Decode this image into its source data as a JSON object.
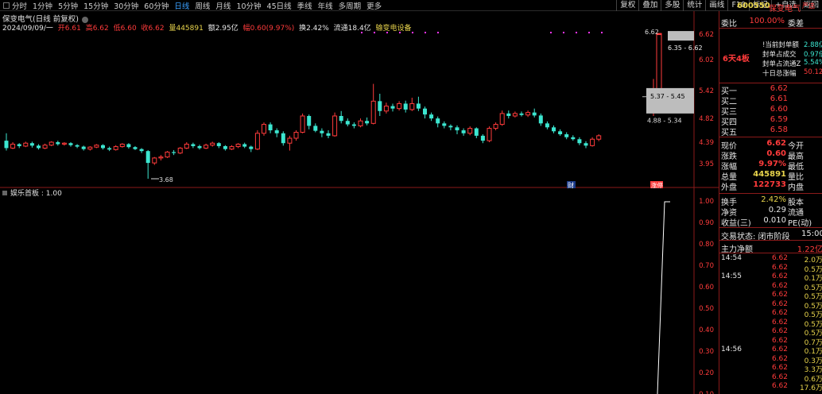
{
  "topbar": {
    "periods": [
      "分时",
      "1分钟",
      "5分钟",
      "15分钟",
      "30分钟",
      "60分钟",
      "日线",
      "周线",
      "月线",
      "10分钟",
      "45日线",
      "季线",
      "年线",
      "多周期",
      "更多"
    ],
    "active_period": "日线",
    "tools": [
      "复权",
      "叠加",
      "多股",
      "统计",
      "画线",
      "F10",
      "标记",
      "+自选",
      "返回"
    ]
  },
  "chart_title": "保变电气(日线 前复权)",
  "info": {
    "date": "2024/09/09/一",
    "open": "开6.61",
    "high": "高6.62",
    "low": "低6.60",
    "close": "收6.62",
    "volume": "量445891",
    "amount": "额2.95亿",
    "change": "幅0.60(9.97%)",
    "turnover": "换2.42%",
    "float": "流通18.4亿",
    "industry": "输变电设备"
  },
  "price_axis": [
    "6.62",
    "6.02",
    "5.42",
    "4.82",
    "4.39",
    "3.95"
  ],
  "price_notes": {
    "low_marker": "3.68",
    "top_marker": "6.62",
    "range1": "6.35 - 6.62",
    "range2": "5.37 - 5.45",
    "range3": "4.88 - 5.34"
  },
  "badges": {
    "cai": "财",
    "zhang": "涨停"
  },
  "indicator": {
    "title": "娱乐首板 : 1.00",
    "axis": [
      "1.00",
      "0.90",
      "0.80",
      "0.70",
      "0.60",
      "0.50",
      "0.40",
      "0.30",
      "0.20",
      "0.10"
    ]
  },
  "stock": {
    "code": "600550",
    "name": "保变电气",
    "tag": "严选",
    "weibi_label": "委比",
    "weibi_value": "100.00%",
    "weicha_label": "委差",
    "board_title": "6天4板",
    "board_stats": [
      {
        "label": "!当前封单额",
        "value": "2.88亿"
      },
      {
        "label": "封单占成交",
        "value": "0.97倍"
      },
      {
        "label": "封单占流通Z",
        "value": "5.54%"
      },
      {
        "label": "十日总涨幅",
        "value": "50.12%"
      }
    ],
    "bids": [
      {
        "label": "买一",
        "price": "6.62"
      },
      {
        "label": "买二",
        "price": "6.61"
      },
      {
        "label": "买三",
        "price": "6.60"
      },
      {
        "label": "买四",
        "price": "6.59"
      },
      {
        "label": "买五",
        "price": "6.58"
      }
    ],
    "quote": [
      {
        "label": "现价",
        "value": "6.62",
        "label2": "今开"
      },
      {
        "label": "涨跌",
        "value": "0.60",
        "label2": "最高"
      },
      {
        "label": "涨幅",
        "value": "9.97%",
        "label2": "最低"
      },
      {
        "label": "总量",
        "value": "445891",
        "label2": "量比"
      },
      {
        "label": "外盘",
        "value": "122733",
        "label2": "内盘"
      }
    ],
    "quote2": [
      {
        "label": "换手",
        "value": "2.42%",
        "label2": "股本"
      },
      {
        "label": "净资",
        "value": "0.29",
        "label2": "流通"
      },
      {
        "label": "收益(三)",
        "value": "0.010",
        "label2": "PE(动)"
      }
    ],
    "trade_status": "交易状态: 闭市阶段",
    "trade_time": "15:00:",
    "main_flow_label": "主力净额",
    "main_flow_value": "1.22亿",
    "ticks": [
      {
        "time": "14:54",
        "price": "6.62",
        "vol": "2.0万"
      },
      {
        "time": "",
        "price": "6.62",
        "vol": "0.5万"
      },
      {
        "time": "14:55",
        "price": "6.62",
        "vol": "0.1万"
      },
      {
        "time": "",
        "price": "6.62",
        "vol": "0.5万"
      },
      {
        "time": "",
        "price": "6.62",
        "vol": "0.5万"
      },
      {
        "time": "",
        "price": "6.62",
        "vol": "0.5万"
      },
      {
        "time": "",
        "price": "6.62",
        "vol": "0.5万"
      },
      {
        "time": "",
        "price": "6.62",
        "vol": "0.5万"
      },
      {
        "time": "",
        "price": "6.62",
        "vol": "0.5万"
      },
      {
        "time": "",
        "price": "6.62",
        "vol": "0.7万"
      },
      {
        "time": "14:56",
        "price": "6.62",
        "vol": "0.1万"
      },
      {
        "time": "",
        "price": "6.62",
        "vol": "0.3万"
      },
      {
        "time": "",
        "price": "6.62",
        "vol": "3.3万"
      },
      {
        "time": "",
        "price": "6.62",
        "vol": "0.6万"
      },
      {
        "time": "",
        "price": "6.62",
        "vol": "17.6万"
      }
    ]
  },
  "colors": {
    "up": "#ff3b3b",
    "down": "#3ce6d0",
    "accent": "#3aa0ff",
    "gridline": "#8b1a1a"
  },
  "chart_data": {
    "type": "candlestick",
    "candles": [
      {
        "o": 4.45,
        "c": 4.3,
        "h": 4.6,
        "l": 4.25
      },
      {
        "o": 4.3,
        "c": 4.38,
        "h": 4.42,
        "l": 4.28
      },
      {
        "o": 4.38,
        "c": 4.34,
        "h": 4.4,
        "l": 4.3
      },
      {
        "o": 4.34,
        "c": 4.4,
        "h": 4.43,
        "l": 4.32
      },
      {
        "o": 4.4,
        "c": 4.35,
        "h": 4.43,
        "l": 4.31
      },
      {
        "o": 4.35,
        "c": 4.3,
        "h": 4.38,
        "l": 4.27
      },
      {
        "o": 4.3,
        "c": 4.36,
        "h": 4.39,
        "l": 4.28
      },
      {
        "o": 4.36,
        "c": 4.42,
        "h": 4.44,
        "l": 4.34
      },
      {
        "o": 4.42,
        "c": 4.38,
        "h": 4.45,
        "l": 4.35
      },
      {
        "o": 4.38,
        "c": 4.4,
        "h": 4.42,
        "l": 4.35
      },
      {
        "o": 4.4,
        "c": 4.36,
        "h": 4.42,
        "l": 4.33
      },
      {
        "o": 4.36,
        "c": 4.33,
        "h": 4.38,
        "l": 4.3
      },
      {
        "o": 4.33,
        "c": 4.28,
        "h": 4.35,
        "l": 4.25
      },
      {
        "o": 4.28,
        "c": 4.32,
        "h": 4.34,
        "l": 4.25
      },
      {
        "o": 4.32,
        "c": 4.36,
        "h": 4.38,
        "l": 4.3
      },
      {
        "o": 4.36,
        "c": 4.3,
        "h": 4.38,
        "l": 4.27
      },
      {
        "o": 4.3,
        "c": 4.27,
        "h": 4.33,
        "l": 4.24
      },
      {
        "o": 4.27,
        "c": 4.33,
        "h": 4.36,
        "l": 4.25
      },
      {
        "o": 4.33,
        "c": 4.38,
        "h": 4.4,
        "l": 4.31
      },
      {
        "o": 4.38,
        "c": 4.32,
        "h": 4.4,
        "l": 4.29
      },
      {
        "o": 4.32,
        "c": 4.28,
        "h": 4.34,
        "l": 4.26
      },
      {
        "o": 4.28,
        "c": 4.24,
        "h": 4.3,
        "l": 4.2
      },
      {
        "o": 4.24,
        "c": 4.0,
        "h": 4.26,
        "l": 3.68
      },
      {
        "o": 4.0,
        "c": 4.1,
        "h": 4.12,
        "l": 3.96
      },
      {
        "o": 4.1,
        "c": 4.12,
        "h": 4.16,
        "l": 4.05
      },
      {
        "o": 4.12,
        "c": 4.22,
        "h": 4.24,
        "l": 4.1
      },
      {
        "o": 4.22,
        "c": 4.2,
        "h": 4.26,
        "l": 4.16
      },
      {
        "o": 4.2,
        "c": 4.3,
        "h": 4.32,
        "l": 4.18
      },
      {
        "o": 4.3,
        "c": 4.38,
        "h": 4.42,
        "l": 4.28
      },
      {
        "o": 4.38,
        "c": 4.34,
        "h": 4.41,
        "l": 4.3
      },
      {
        "o": 4.34,
        "c": 4.3,
        "h": 4.37,
        "l": 4.27
      },
      {
        "o": 4.3,
        "c": 4.36,
        "h": 4.39,
        "l": 4.28
      },
      {
        "o": 4.36,
        "c": 4.4,
        "h": 4.43,
        "l": 4.33
      },
      {
        "o": 4.4,
        "c": 4.34,
        "h": 4.42,
        "l": 4.3
      },
      {
        "o": 4.34,
        "c": 4.28,
        "h": 4.36,
        "l": 4.25
      },
      {
        "o": 4.28,
        "c": 4.33,
        "h": 4.36,
        "l": 4.26
      },
      {
        "o": 4.33,
        "c": 4.38,
        "h": 4.4,
        "l": 4.3
      },
      {
        "o": 4.38,
        "c": 4.33,
        "h": 4.41,
        "l": 4.3
      },
      {
        "o": 4.33,
        "c": 4.28,
        "h": 4.35,
        "l": 4.22
      },
      {
        "o": 4.28,
        "c": 4.6,
        "h": 4.66,
        "l": 4.26
      },
      {
        "o": 4.6,
        "c": 4.78,
        "h": 4.82,
        "l": 4.55
      },
      {
        "o": 4.78,
        "c": 4.66,
        "h": 4.82,
        "l": 4.6
      },
      {
        "o": 4.66,
        "c": 4.6,
        "h": 4.7,
        "l": 4.52
      },
      {
        "o": 4.6,
        "c": 4.4,
        "h": 4.64,
        "l": 4.35
      },
      {
        "o": 4.4,
        "c": 4.5,
        "h": 4.55,
        "l": 4.25
      },
      {
        "o": 4.5,
        "c": 4.62,
        "h": 4.66,
        "l": 4.45
      },
      {
        "o": 4.62,
        "c": 4.95,
        "h": 5.0,
        "l": 4.6
      },
      {
        "o": 4.95,
        "c": 4.75,
        "h": 4.98,
        "l": 4.68
      },
      {
        "o": 4.75,
        "c": 4.65,
        "h": 4.8,
        "l": 4.62
      },
      {
        "o": 4.65,
        "c": 4.6,
        "h": 4.7,
        "l": 4.52
      },
      {
        "o": 4.6,
        "c": 4.55,
        "h": 4.66,
        "l": 4.5
      },
      {
        "o": 4.55,
        "c": 4.95,
        "h": 5.02,
        "l": 4.53
      },
      {
        "o": 4.95,
        "c": 4.85,
        "h": 5.05,
        "l": 4.8
      },
      {
        "o": 4.85,
        "c": 4.78,
        "h": 4.9,
        "l": 4.74
      },
      {
        "o": 4.78,
        "c": 4.75,
        "h": 4.82,
        "l": 4.7
      },
      {
        "o": 4.75,
        "c": 4.85,
        "h": 4.9,
        "l": 4.72
      },
      {
        "o": 4.85,
        "c": 4.8,
        "h": 4.92,
        "l": 4.76
      },
      {
        "o": 4.8,
        "c": 5.25,
        "h": 5.6,
        "l": 4.78
      },
      {
        "o": 5.25,
        "c": 5.05,
        "h": 5.4,
        "l": 4.95
      },
      {
        "o": 5.05,
        "c": 5.15,
        "h": 5.22,
        "l": 5.0
      },
      {
        "o": 5.15,
        "c": 5.1,
        "h": 5.2,
        "l": 5.04
      },
      {
        "o": 5.1,
        "c": 5.2,
        "h": 5.25,
        "l": 5.06
      },
      {
        "o": 5.2,
        "c": 5.08,
        "h": 5.26,
        "l": 5.02
      },
      {
        "o": 5.08,
        "c": 5.2,
        "h": 5.32,
        "l": 5.05
      },
      {
        "o": 5.2,
        "c": 5.1,
        "h": 5.34,
        "l": 5.05
      },
      {
        "o": 5.1,
        "c": 4.98,
        "h": 5.14,
        "l": 4.9
      },
      {
        "o": 4.98,
        "c": 4.9,
        "h": 5.02,
        "l": 4.85
      },
      {
        "o": 4.9,
        "c": 4.8,
        "h": 4.94,
        "l": 4.72
      },
      {
        "o": 4.8,
        "c": 4.75,
        "h": 4.84,
        "l": 4.7
      },
      {
        "o": 4.75,
        "c": 4.72,
        "h": 4.78,
        "l": 4.66
      },
      {
        "o": 4.72,
        "c": 4.66,
        "h": 4.76,
        "l": 4.58
      },
      {
        "o": 4.66,
        "c": 4.6,
        "h": 4.7,
        "l": 4.55
      },
      {
        "o": 4.6,
        "c": 4.7,
        "h": 4.74,
        "l": 4.56
      },
      {
        "o": 4.7,
        "c": 4.55,
        "h": 4.72,
        "l": 4.5
      },
      {
        "o": 4.55,
        "c": 4.45,
        "h": 4.58,
        "l": 4.4
      },
      {
        "o": 4.45,
        "c": 4.7,
        "h": 4.74,
        "l": 4.42
      },
      {
        "o": 4.7,
        "c": 4.78,
        "h": 4.82,
        "l": 4.66
      },
      {
        "o": 4.78,
        "c": 5.0,
        "h": 5.06,
        "l": 4.75
      },
      {
        "o": 5.0,
        "c": 4.95,
        "h": 5.06,
        "l": 4.9
      },
      {
        "o": 4.95,
        "c": 5.0,
        "h": 5.04,
        "l": 4.92
      },
      {
        "o": 5.0,
        "c": 4.97,
        "h": 5.04,
        "l": 4.94
      },
      {
        "o": 4.97,
        "c": 5.02,
        "h": 5.06,
        "l": 4.93
      },
      {
        "o": 5.02,
        "c": 4.96,
        "h": 5.1,
        "l": 4.92
      },
      {
        "o": 4.96,
        "c": 4.8,
        "h": 5.0,
        "l": 4.75
      },
      {
        "o": 4.8,
        "c": 4.72,
        "h": 4.84,
        "l": 4.68
      },
      {
        "o": 4.72,
        "c": 4.64,
        "h": 4.76,
        "l": 4.6
      },
      {
        "o": 4.64,
        "c": 4.58,
        "h": 4.68,
        "l": 4.55
      },
      {
        "o": 4.58,
        "c": 4.52,
        "h": 4.62,
        "l": 4.48
      },
      {
        "o": 4.52,
        "c": 4.48,
        "h": 4.56,
        "l": 4.45
      },
      {
        "o": 4.48,
        "c": 4.4,
        "h": 4.52,
        "l": 4.36
      },
      {
        "o": 4.4,
        "c": 4.35,
        "h": 4.44,
        "l": 4.3
      },
      {
        "o": 4.35,
        "c": 4.48,
        "h": 4.52,
        "l": 4.33
      },
      {
        "o": 4.48,
        "c": 4.55,
        "h": 4.58,
        "l": 4.44
      }
    ],
    "ylim": [
      3.6,
      6.75
    ]
  }
}
